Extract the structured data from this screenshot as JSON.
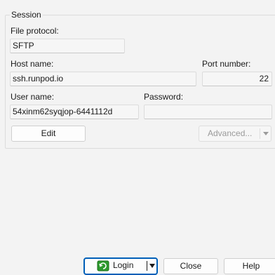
{
  "session": {
    "legend": "Session",
    "file_protocol": {
      "label": "File protocol:",
      "value": "SFTP"
    },
    "host_name": {
      "label": "Host name:",
      "value": "ssh.runpod.io"
    },
    "port_number": {
      "label": "Port number:",
      "value": "22"
    },
    "user_name": {
      "label": "User name:",
      "value": "54xinm62syqjop-6441112d"
    },
    "password": {
      "label": "Password:",
      "value": ""
    },
    "edit_label": "Edit",
    "advanced_label": "Advanced..."
  },
  "footer": {
    "login_label": "Login",
    "close_label": "Close",
    "help_label": "Help"
  }
}
